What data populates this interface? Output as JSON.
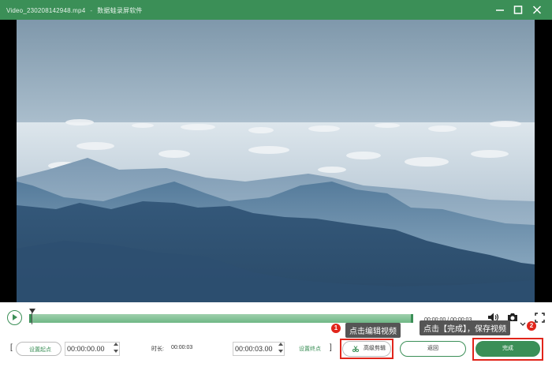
{
  "titlebar": {
    "filename": "Video_230208142948.mp4",
    "separator": "-",
    "app_name": "数据蛙录屏软件"
  },
  "player": {
    "time_display": "00:00:00 / 00:00:03"
  },
  "trim": {
    "set_start_label": "设置起点",
    "start_time": "00:00:00.00",
    "duration_label": "时长:",
    "duration_value": "00:00:03",
    "end_time": "00:00:03.00",
    "set_end_label": "设置终点",
    "bracket_open": "[",
    "bracket_close": "]"
  },
  "buttons": {
    "advanced_edit": "高级剪辑",
    "back": "返回",
    "done": "完成"
  },
  "tips": {
    "tip1_number": "1",
    "tip1_text": "点击编辑视频",
    "tip2_number": "2",
    "tip2_text": "点击【完成】，保存视频"
  },
  "colors": {
    "brand": "#3b8f57",
    "highlight": "#e1251b"
  }
}
